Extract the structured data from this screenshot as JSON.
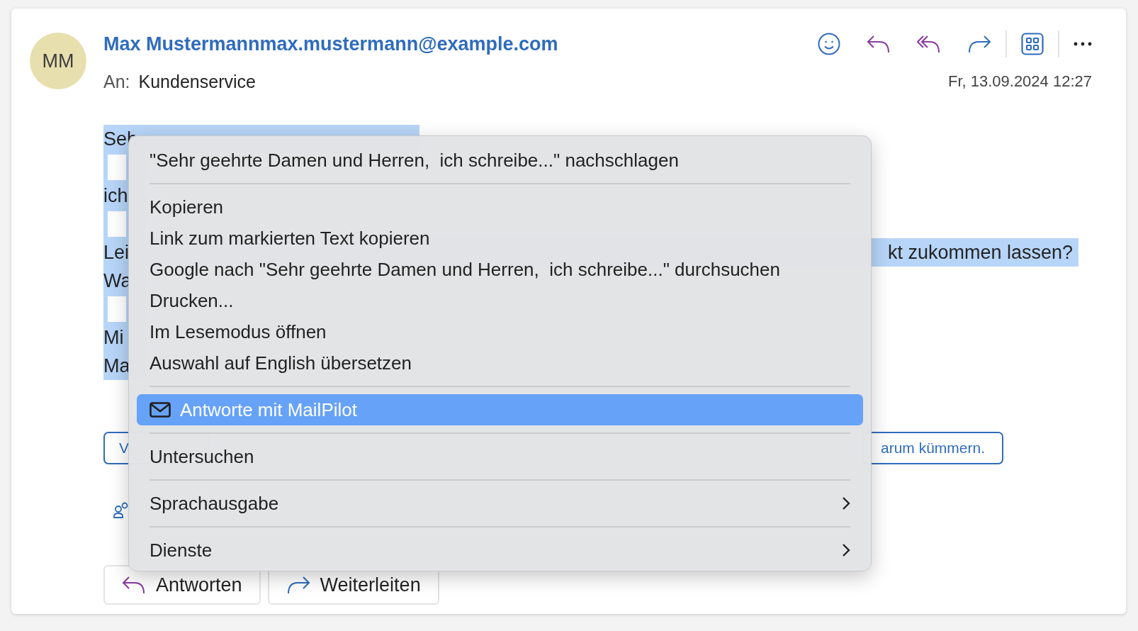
{
  "message": {
    "avatar_initials": "MM",
    "sender": "Max Mustermannmax.mustermann@example.com",
    "to_label": "An:",
    "to": "Kundenservice",
    "date": "Fr, 13.09.2024 12:27"
  },
  "body_lines": [
    {
      "kind": "text",
      "text": "Seh",
      "selected": true
    },
    {
      "kind": "blank",
      "selected": true
    },
    {
      "kind": "text",
      "text": "ich",
      "selected": true
    },
    {
      "kind": "blank",
      "selected": true
    },
    {
      "kind": "text",
      "text": "Lei",
      "tail": "kt zukommen lassen?",
      "selected": true
    },
    {
      "kind": "text",
      "text": "Wa",
      "selected": true
    },
    {
      "kind": "blank",
      "selected": true
    },
    {
      "kind": "text",
      "text": "Mi",
      "selected": true
    },
    {
      "kind": "text",
      "text": "Ma",
      "selected": true
    }
  ],
  "notice_buttons": [
    "V",
    "arum kümmern."
  ],
  "action_buttons": [
    {
      "kind": "reply",
      "label": "Antworten"
    },
    {
      "kind": "forward",
      "label": "Weiterleiten"
    }
  ],
  "context_menu": [
    {
      "kind": "item",
      "label": "\"Sehr geehrte Damen und Herren,  ich schreibe...\" nachschlagen",
      "selected": false,
      "submenu": false
    },
    {
      "kind": "separator"
    },
    {
      "kind": "item",
      "label": "Kopieren",
      "selected": false,
      "submenu": false
    },
    {
      "kind": "item",
      "label": "Link zum markierten Text kopieren",
      "selected": false,
      "submenu": false
    },
    {
      "kind": "item",
      "label": "Google nach \"Sehr geehrte Damen und Herren,  ich schreibe...\" durchsuchen",
      "selected": false,
      "submenu": false
    },
    {
      "kind": "item",
      "label": "Drucken...",
      "selected": false,
      "submenu": false
    },
    {
      "kind": "item",
      "label": "Im Lesemodus öffnen",
      "selected": false,
      "submenu": false
    },
    {
      "kind": "item",
      "label": "Auswahl auf English übersetzen",
      "selected": false,
      "submenu": false
    },
    {
      "kind": "separator"
    },
    {
      "kind": "extension",
      "label": "Antworte mit MailPilot",
      "selected": true,
      "submenu": false
    },
    {
      "kind": "separator"
    },
    {
      "kind": "item",
      "label": "Untersuchen",
      "selected": false,
      "submenu": false
    },
    {
      "kind": "separator"
    },
    {
      "kind": "item",
      "label": "Sprachausgabe",
      "selected": false,
      "submenu": true
    },
    {
      "kind": "separator"
    },
    {
      "kind": "item",
      "label": "Dienste",
      "selected": false,
      "submenu": true
    }
  ]
}
